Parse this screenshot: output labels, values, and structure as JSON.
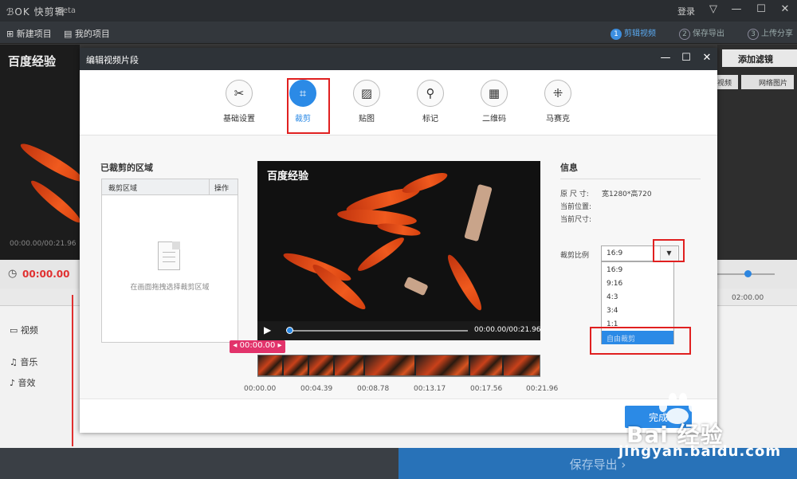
{
  "app": {
    "logo": "ℬOK 快剪辑",
    "beta": "Beta",
    "login": "登录"
  },
  "window_controls": {
    "menu": "▽",
    "minimize": "—",
    "maximize": "☐",
    "close": "✕"
  },
  "toolbar": {
    "new_project": "新建项目",
    "my_projects": "我的项目",
    "steps": [
      {
        "num": "1",
        "label": "剪辑视频"
      },
      {
        "num": "2",
        "label": "保存导出"
      },
      {
        "num": "3",
        "label": "上传分享"
      }
    ]
  },
  "background": {
    "preview_title": "百度经验",
    "preview_time": "00:00.00/00:21.96",
    "add_filter": "添加滤镜",
    "video_btn": "视频",
    "web_image_btn": "网络图片",
    "current_time": "00:00.00",
    "ruler_label": "02:00.00",
    "tracks": [
      "视频",
      "音乐",
      "音效"
    ],
    "save_export": "保存导出 ›"
  },
  "dialog": {
    "title": "编辑视频片段",
    "tabs": [
      {
        "label": "基础设置",
        "icon": "scissors-icon"
      },
      {
        "label": "裁剪",
        "icon": "crop-icon"
      },
      {
        "label": "贴图",
        "icon": "image-icon"
      },
      {
        "label": "标记",
        "icon": "pin-icon"
      },
      {
        "label": "二维码",
        "icon": "qrcode-icon"
      },
      {
        "label": "马赛克",
        "icon": "mosaic-icon"
      }
    ],
    "cropped_title": "已裁剪的区域",
    "table_headers": [
      "裁剪区域",
      "操作"
    ],
    "empty_hint": "在画面拖拽选择裁剪区域",
    "video_title": "百度经验",
    "video_time": "00:00.00/00:21.96",
    "marker_time": "00:00.00",
    "ticks": [
      "00:00.00",
      "00:04.39",
      "00:08.78",
      "00:13.17",
      "00:17.56",
      "00:21.96"
    ],
    "info": {
      "title": "信息",
      "original_size_label": "原 尺 寸:",
      "original_size_value": "宽1280*高720",
      "current_pos_label": "当前位置:",
      "current_size_label": "当前尺寸:",
      "ratio_label": "裁剪比例",
      "ratio_selected": "16:9",
      "ratio_options": [
        "16:9",
        "9:16",
        "4:3",
        "3:4",
        "1:1",
        "自由裁剪"
      ]
    },
    "done_button": "完成"
  },
  "watermark": {
    "brand": "Bai  经验",
    "url": "jingyan.baidu.com"
  },
  "colors": {
    "accent": "#2b8ae6",
    "highlight": "#e02020",
    "marker": "#e2336b"
  }
}
